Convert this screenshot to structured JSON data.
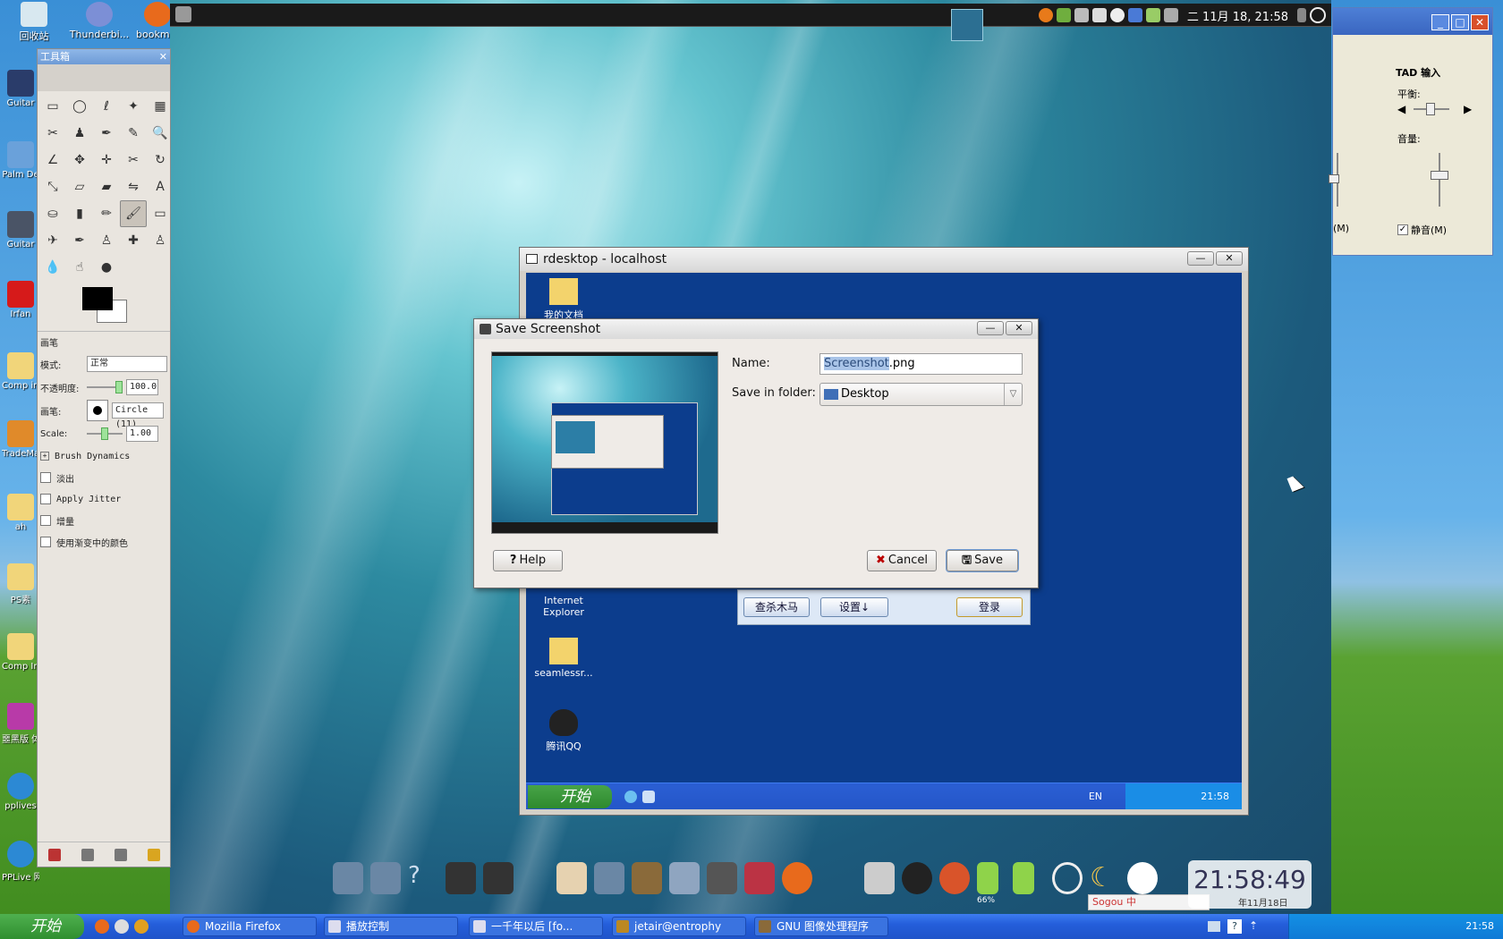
{
  "top_icons": [
    {
      "label": "回收站",
      "icon": "recycle-bin-icon"
    },
    {
      "label": "Thunderbi...",
      "icon": "thunderbird-icon"
    },
    {
      "label": "bookmark",
      "icon": "firefox-icon"
    }
  ],
  "left_icons": [
    {
      "label": "Guitar",
      "icon": "guitar-icon"
    },
    {
      "label": "Palm De",
      "icon": "palm-icon"
    },
    {
      "label": "Guitar",
      "icon": "guitar-icon"
    },
    {
      "label": "Irfan",
      "icon": "irfanview-icon"
    },
    {
      "label": "Comp imag",
      "icon": "folder-icon"
    },
    {
      "label": "TradeMa",
      "icon": "trademark-icon"
    },
    {
      "label": "ah",
      "icon": "folder-icon"
    },
    {
      "label": "PS素",
      "icon": "folder-icon"
    },
    {
      "label": "Comp Ima",
      "icon": "folder-icon"
    },
    {
      "label": "噩黑版 体.",
      "icon": "winrar-icon"
    },
    {
      "label": "pplives",
      "icon": "pplive-icon"
    },
    {
      "label": "PPLive 网络 电视",
      "icon": "pplive-icon"
    }
  ],
  "linux_panel": {
    "clock": "二 11月 18, 21:58"
  },
  "gimp": {
    "title": "工具箱",
    "tool_icons": [
      "rect-select-icon",
      "ellipse-select-icon",
      "lasso-icon",
      "fuzzy-select-icon",
      "color-select-icon",
      "scissors-icon",
      "foreground-select-icon",
      "paths-icon",
      "color-picker-icon",
      "zoom-icon",
      "measure-icon",
      "move-icon",
      "align-icon",
      "crop-icon",
      "rotate-icon",
      "scale-icon",
      "shear-icon",
      "perspective-icon",
      "flip-icon",
      "text-icon",
      "bucket-fill-icon",
      "blend-icon",
      "pencil-icon",
      "paintbrush-icon",
      "eraser-icon",
      "airbrush-icon",
      "ink-icon",
      "clone-icon",
      "heal-icon",
      "perspective-clone-icon",
      "blur-icon",
      "smudge-icon",
      "dodge-burn-icon"
    ],
    "tool_glyphs": [
      "▭",
      "◯",
      "ℓ",
      "✦",
      "▦",
      "✂",
      "♟",
      "✒",
      "✎",
      "🔍",
      "∠",
      "✥",
      "✛",
      "✂",
      "↻",
      "⤡",
      "▱",
      "▰",
      "⇋",
      "A",
      "⛀",
      "▮",
      "✏",
      "🖌",
      "▭",
      "✈",
      "✒",
      "♙",
      "✚",
      "♙",
      "💧",
      "☝",
      "●"
    ],
    "options_title": "画笔",
    "mode_label": "模式:",
    "mode_value": "正常",
    "opacity_label": "不透明度:",
    "opacity_value": "100.0",
    "brush_label": "画笔:",
    "brush_value": "Circle (11)",
    "scale_label": "Scale:",
    "scale_value": "1.00",
    "brush_dynamics": "Brush Dynamics",
    "checkboxes": [
      "淡出",
      "Apply Jitter",
      "增量",
      "使用渐变中的颜色"
    ]
  },
  "mixer": {
    "title": "TAD 输入",
    "balance_label": "平衡:",
    "volume_label": "音量:",
    "mute_label": "静音(M)",
    "left_mute_label": "(M)"
  },
  "rdesktop": {
    "title": "rdesktop - localhost",
    "desktop_icons": [
      {
        "label": "我的文档",
        "icon": "my-documents-icon"
      },
      {
        "label": "Internet Explorer",
        "icon": "ie-icon"
      },
      {
        "label": "seamlessr...",
        "icon": "zip-folder-icon"
      },
      {
        "label": "腾讯QQ",
        "icon": "qq-icon"
      }
    ],
    "qq_buttons": {
      "scan": "查杀木马",
      "settings": "设置↓",
      "login": "登录"
    },
    "start_label": "开始",
    "lang": "EN",
    "tray_time": "21:58"
  },
  "dialog": {
    "title": "Save Screenshot",
    "name_label": "Name:",
    "name_value_selected": "Screenshot",
    "name_value_rest": ".png",
    "folder_label": "Save in folder:",
    "folder_value": "Desktop",
    "help_label": "Help",
    "cancel_label": "Cancel",
    "save_label": "Save"
  },
  "dock": {
    "clock": "21:58:49",
    "date": "年11月18日",
    "battery_label": "66%",
    "sogou": "Sogou 中"
  },
  "taskbar": {
    "start_label": "开始",
    "tasks": [
      {
        "label": "Mozilla Firefox",
        "icon": "firefox-icon"
      },
      {
        "label": "播放控制",
        "icon": "media-icon"
      },
      {
        "label": "一千年以后  [fo...",
        "icon": "music-icon"
      },
      {
        "label": "jetair@entrophy",
        "icon": "terminal-icon"
      },
      {
        "label": "GNU 图像处理程序",
        "icon": "gimp-icon"
      }
    ],
    "time": "21:58"
  }
}
